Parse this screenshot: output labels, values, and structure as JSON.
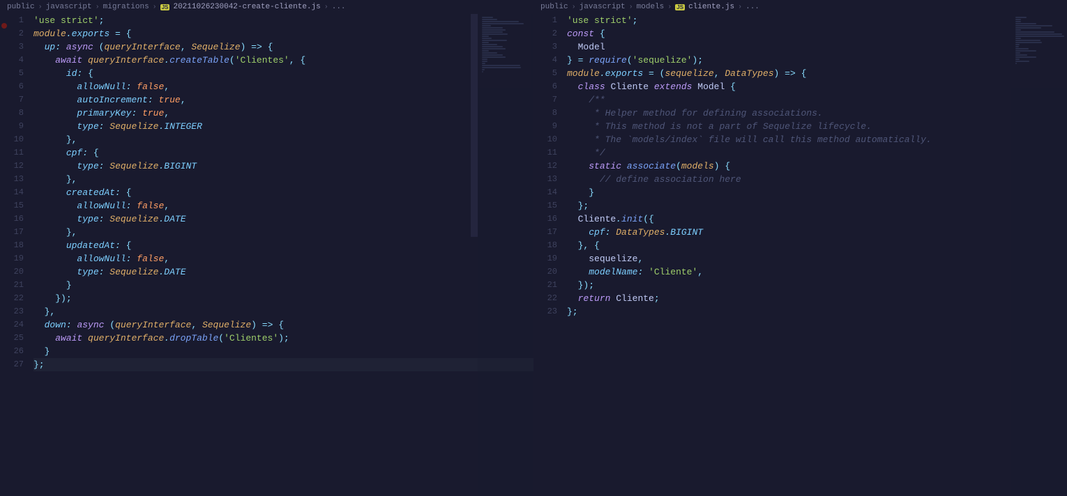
{
  "left": {
    "breadcrumb": [
      "public",
      "javascript",
      "migrations",
      "20211026230042-create-cliente.js",
      "..."
    ],
    "lineCount": 27,
    "code": [
      [
        [
          "str",
          "'use strict'"
        ],
        [
          "pun",
          ";"
        ]
      ],
      [
        [
          "var",
          "module"
        ],
        [
          "op",
          "."
        ],
        [
          "prop",
          "exports"
        ],
        [
          "cls",
          " "
        ],
        [
          "op",
          "="
        ],
        [
          "cls",
          " "
        ],
        [
          "pun",
          "{"
        ]
      ],
      [
        [
          "cls",
          "  "
        ],
        [
          "prop",
          "up"
        ],
        [
          "op",
          ":"
        ],
        [
          "cls",
          " "
        ],
        [
          "kw",
          "async"
        ],
        [
          "cls",
          " "
        ],
        [
          "pun",
          "("
        ],
        [
          "var",
          "queryInterface"
        ],
        [
          "pun",
          ","
        ],
        [
          "cls",
          " "
        ],
        [
          "var",
          "Sequelize"
        ],
        [
          "pun",
          ")"
        ],
        [
          "cls",
          " "
        ],
        [
          "op",
          "=>"
        ],
        [
          "cls",
          " "
        ],
        [
          "pun",
          "{"
        ]
      ],
      [
        [
          "cls",
          "    "
        ],
        [
          "kw",
          "await"
        ],
        [
          "cls",
          " "
        ],
        [
          "var",
          "queryInterface"
        ],
        [
          "op",
          "."
        ],
        [
          "fn",
          "createTable"
        ],
        [
          "pun",
          "("
        ],
        [
          "str",
          "'Clientes'"
        ],
        [
          "pun",
          ","
        ],
        [
          "cls",
          " "
        ],
        [
          "pun",
          "{"
        ]
      ],
      [
        [
          "cls",
          "      "
        ],
        [
          "prop",
          "id"
        ],
        [
          "op",
          ":"
        ],
        [
          "cls",
          " "
        ],
        [
          "pun",
          "{"
        ]
      ],
      [
        [
          "cls",
          "        "
        ],
        [
          "prop",
          "allowNull"
        ],
        [
          "op",
          ":"
        ],
        [
          "cls",
          " "
        ],
        [
          "num",
          "false"
        ],
        [
          "pun",
          ","
        ]
      ],
      [
        [
          "cls",
          "        "
        ],
        [
          "prop",
          "autoIncrement"
        ],
        [
          "op",
          ":"
        ],
        [
          "cls",
          " "
        ],
        [
          "num",
          "true"
        ],
        [
          "pun",
          ","
        ]
      ],
      [
        [
          "cls",
          "        "
        ],
        [
          "prop",
          "primaryKey"
        ],
        [
          "op",
          ":"
        ],
        [
          "cls",
          " "
        ],
        [
          "num",
          "true"
        ],
        [
          "pun",
          ","
        ]
      ],
      [
        [
          "cls",
          "        "
        ],
        [
          "prop",
          "type"
        ],
        [
          "op",
          ":"
        ],
        [
          "cls",
          " "
        ],
        [
          "var",
          "Sequelize"
        ],
        [
          "op",
          "."
        ],
        [
          "prop",
          "INTEGER"
        ]
      ],
      [
        [
          "cls",
          "      "
        ],
        [
          "pun",
          "},"
        ]
      ],
      [
        [
          "cls",
          "      "
        ],
        [
          "prop",
          "cpf"
        ],
        [
          "op",
          ":"
        ],
        [
          "cls",
          " "
        ],
        [
          "pun",
          "{"
        ]
      ],
      [
        [
          "cls",
          "        "
        ],
        [
          "prop",
          "type"
        ],
        [
          "op",
          ":"
        ],
        [
          "cls",
          " "
        ],
        [
          "var",
          "Sequelize"
        ],
        [
          "op",
          "."
        ],
        [
          "prop",
          "BIGINT"
        ]
      ],
      [
        [
          "cls",
          "      "
        ],
        [
          "pun",
          "},"
        ]
      ],
      [
        [
          "cls",
          "      "
        ],
        [
          "prop",
          "createdAt"
        ],
        [
          "op",
          ":"
        ],
        [
          "cls",
          " "
        ],
        [
          "pun",
          "{"
        ]
      ],
      [
        [
          "cls",
          "        "
        ],
        [
          "prop",
          "allowNull"
        ],
        [
          "op",
          ":"
        ],
        [
          "cls",
          " "
        ],
        [
          "num",
          "false"
        ],
        [
          "pun",
          ","
        ]
      ],
      [
        [
          "cls",
          "        "
        ],
        [
          "prop",
          "type"
        ],
        [
          "op",
          ":"
        ],
        [
          "cls",
          " "
        ],
        [
          "var",
          "Sequelize"
        ],
        [
          "op",
          "."
        ],
        [
          "prop",
          "DATE"
        ]
      ],
      [
        [
          "cls",
          "      "
        ],
        [
          "pun",
          "},"
        ]
      ],
      [
        [
          "cls",
          "      "
        ],
        [
          "prop",
          "updatedAt"
        ],
        [
          "op",
          ":"
        ],
        [
          "cls",
          " "
        ],
        [
          "pun",
          "{"
        ]
      ],
      [
        [
          "cls",
          "        "
        ],
        [
          "prop",
          "allowNull"
        ],
        [
          "op",
          ":"
        ],
        [
          "cls",
          " "
        ],
        [
          "num",
          "false"
        ],
        [
          "pun",
          ","
        ]
      ],
      [
        [
          "cls",
          "        "
        ],
        [
          "prop",
          "type"
        ],
        [
          "op",
          ":"
        ],
        [
          "cls",
          " "
        ],
        [
          "var",
          "Sequelize"
        ],
        [
          "op",
          "."
        ],
        [
          "prop",
          "DATE"
        ]
      ],
      [
        [
          "cls",
          "      "
        ],
        [
          "pun",
          "}"
        ]
      ],
      [
        [
          "cls",
          "    "
        ],
        [
          "pun",
          "});"
        ]
      ],
      [
        [
          "cls",
          "  "
        ],
        [
          "pun",
          "},"
        ]
      ],
      [
        [
          "cls",
          "  "
        ],
        [
          "prop",
          "down"
        ],
        [
          "op",
          ":"
        ],
        [
          "cls",
          " "
        ],
        [
          "kw",
          "async"
        ],
        [
          "cls",
          " "
        ],
        [
          "pun",
          "("
        ],
        [
          "var",
          "queryInterface"
        ],
        [
          "pun",
          ","
        ],
        [
          "cls",
          " "
        ],
        [
          "var",
          "Sequelize"
        ],
        [
          "pun",
          ")"
        ],
        [
          "cls",
          " "
        ],
        [
          "op",
          "=>"
        ],
        [
          "cls",
          " "
        ],
        [
          "pun",
          "{"
        ]
      ],
      [
        [
          "cls",
          "    "
        ],
        [
          "kw",
          "await"
        ],
        [
          "cls",
          " "
        ],
        [
          "var",
          "queryInterface"
        ],
        [
          "op",
          "."
        ],
        [
          "fn",
          "dropTable"
        ],
        [
          "pun",
          "("
        ],
        [
          "str",
          "'Clientes'"
        ],
        [
          "pun",
          ");"
        ]
      ],
      [
        [
          "cls",
          "  "
        ],
        [
          "pun",
          "}"
        ]
      ],
      [
        [
          "pun",
          "};"
        ]
      ]
    ]
  },
  "right": {
    "breadcrumb": [
      "public",
      "javascript",
      "models",
      "cliente.js",
      "..."
    ],
    "lineCount": 23,
    "code": [
      [
        [
          "str",
          "'use strict'"
        ],
        [
          "pun",
          ";"
        ]
      ],
      [
        [
          "kw",
          "const"
        ],
        [
          "cls",
          " "
        ],
        [
          "pun",
          "{"
        ]
      ],
      [
        [
          "cls",
          "  "
        ],
        [
          "cls",
          "Model"
        ]
      ],
      [
        [
          "pun",
          "}"
        ],
        [
          "cls",
          " "
        ],
        [
          "op",
          "="
        ],
        [
          "cls",
          " "
        ],
        [
          "fn",
          "require"
        ],
        [
          "pun",
          "("
        ],
        [
          "str",
          "'sequelize'"
        ],
        [
          "pun",
          ");"
        ]
      ],
      [
        [
          "var",
          "module"
        ],
        [
          "op",
          "."
        ],
        [
          "prop",
          "exports"
        ],
        [
          "cls",
          " "
        ],
        [
          "op",
          "="
        ],
        [
          "cls",
          " "
        ],
        [
          "pun",
          "("
        ],
        [
          "var",
          "sequelize"
        ],
        [
          "pun",
          ","
        ],
        [
          "cls",
          " "
        ],
        [
          "var",
          "DataTypes"
        ],
        [
          "pun",
          ")"
        ],
        [
          "cls",
          " "
        ],
        [
          "op",
          "=>"
        ],
        [
          "cls",
          " "
        ],
        [
          "pun",
          "{"
        ]
      ],
      [
        [
          "cls",
          "  "
        ],
        [
          "kw",
          "class"
        ],
        [
          "cls",
          " "
        ],
        [
          "cls",
          "Cliente"
        ],
        [
          "cls",
          " "
        ],
        [
          "kw",
          "extends"
        ],
        [
          "cls",
          " "
        ],
        [
          "cls",
          "Model"
        ],
        [
          "cls",
          " "
        ],
        [
          "pun",
          "{"
        ]
      ],
      [
        [
          "cls",
          "    "
        ],
        [
          "cm",
          "/**"
        ]
      ],
      [
        [
          "cls",
          "    "
        ],
        [
          "cm",
          " * Helper method for defining associations."
        ]
      ],
      [
        [
          "cls",
          "    "
        ],
        [
          "cm",
          " * This method is not a part of Sequelize lifecycle."
        ]
      ],
      [
        [
          "cls",
          "    "
        ],
        [
          "cm",
          " * The `models/index` file will call this method automatically."
        ]
      ],
      [
        [
          "cls",
          "    "
        ],
        [
          "cm",
          " */"
        ]
      ],
      [
        [
          "cls",
          "    "
        ],
        [
          "kw",
          "static"
        ],
        [
          "cls",
          " "
        ],
        [
          "fn",
          "associate"
        ],
        [
          "pun",
          "("
        ],
        [
          "var",
          "models"
        ],
        [
          "pun",
          ")"
        ],
        [
          "cls",
          " "
        ],
        [
          "pun",
          "{"
        ]
      ],
      [
        [
          "cls",
          "      "
        ],
        [
          "cm",
          "// define association here"
        ]
      ],
      [
        [
          "cls",
          "    "
        ],
        [
          "pun",
          "}"
        ]
      ],
      [
        [
          "cls",
          "  "
        ],
        [
          "pun",
          "};"
        ]
      ],
      [
        [
          "cls",
          "  "
        ],
        [
          "cls",
          "Cliente"
        ],
        [
          "op",
          "."
        ],
        [
          "fn",
          "init"
        ],
        [
          "pun",
          "({"
        ]
      ],
      [
        [
          "cls",
          "    "
        ],
        [
          "prop",
          "cpf"
        ],
        [
          "op",
          ":"
        ],
        [
          "cls",
          " "
        ],
        [
          "var",
          "DataTypes"
        ],
        [
          "op",
          "."
        ],
        [
          "prop",
          "BIGINT"
        ]
      ],
      [
        [
          "cls",
          "  "
        ],
        [
          "pun",
          "},"
        ],
        [
          "cls",
          " "
        ],
        [
          "pun",
          "{"
        ]
      ],
      [
        [
          "cls",
          "    "
        ],
        [
          "cls",
          "sequelize"
        ],
        [
          "pun",
          ","
        ]
      ],
      [
        [
          "cls",
          "    "
        ],
        [
          "prop",
          "modelName"
        ],
        [
          "op",
          ":"
        ],
        [
          "cls",
          " "
        ],
        [
          "str",
          "'Cliente'"
        ],
        [
          "pun",
          ","
        ]
      ],
      [
        [
          "cls",
          "  "
        ],
        [
          "pun",
          "});"
        ]
      ],
      [
        [
          "cls",
          "  "
        ],
        [
          "kw",
          "return"
        ],
        [
          "cls",
          " "
        ],
        [
          "cls",
          "Cliente"
        ],
        [
          "pun",
          ";"
        ]
      ],
      [
        [
          "pun",
          "};"
        ]
      ]
    ]
  }
}
